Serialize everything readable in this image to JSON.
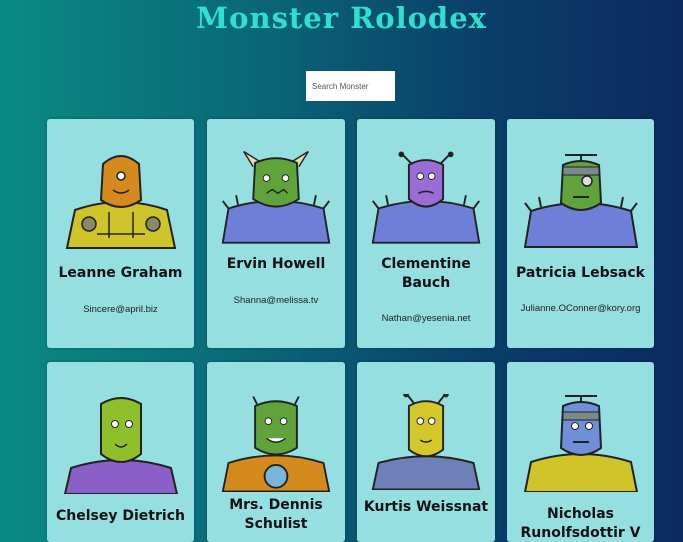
{
  "title": "Monster Rolodex",
  "search": {
    "placeholder": "Search Monster"
  },
  "monsters": [
    {
      "name": "Leanne Graham",
      "email": "Sincere@april.biz"
    },
    {
      "name": "Ervin Howell",
      "email": "Shanna@melissa.tv"
    },
    {
      "name": "Clementine Bauch",
      "email": "Nathan@yesenia.net"
    },
    {
      "name": "Patricia Lebsack",
      "email": "Julianne.OConner@kory.org"
    },
    {
      "name": "Chelsey Dietrich",
      "email": ""
    },
    {
      "name": "Mrs. Dennis Schulist",
      "email": ""
    },
    {
      "name": "Kurtis Weissnat",
      "email": ""
    },
    {
      "name": "Nicholas Runolfsdottir V",
      "email": ""
    }
  ],
  "colors": {
    "card": "#95dfe0",
    "title": "#2fe0cf"
  }
}
